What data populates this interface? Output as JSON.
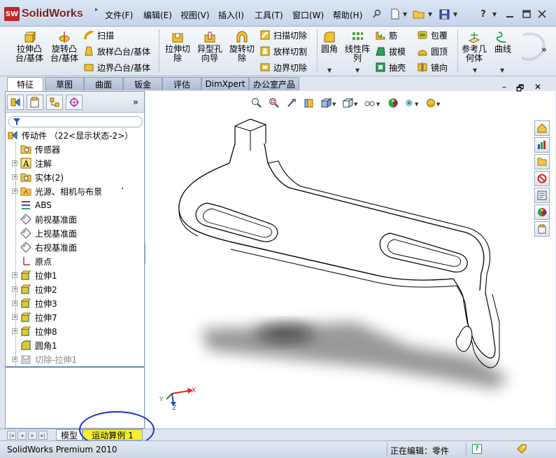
{
  "app": {
    "logo_text": "SolidWorks",
    "logo_badge": "SW"
  },
  "menu": [
    "文件(F)",
    "编辑(E)",
    "视图(V)",
    "插入(I)",
    "工具(T)",
    "窗口(W)",
    "帮助(H)"
  ],
  "toolbar_icons": [
    "pin-icon",
    "new-doc-icon",
    "open-folder-icon",
    "save-icon",
    "help-icon",
    "minimize-icon",
    "restore-icon",
    "close-icon"
  ],
  "commands": {
    "extrude_boss": "拉伸凸台/基体",
    "revolve_boss": "旋转凸台/基体",
    "sweep": "扫描",
    "loft_boss": "放样凸台/基体",
    "boundary_boss": "边界凸台/基体",
    "extrude_cut": "拉伸切除",
    "hole_wizard": "异型孔向导",
    "revolve_cut": "旋转切除",
    "swept_cut": "扫描切除",
    "lofted_cut": "放样切割",
    "boundary_cut": "边界切除",
    "fillet": "圆角",
    "linear_pattern": "线性阵列",
    "rib": "筋",
    "draft": "拔模",
    "shell": "抽壳",
    "wrap": "包覆",
    "dome": "圆顶",
    "mirror": "镜向",
    "ref_geometry": "参考几何体",
    "curves": "曲线"
  },
  "tabs": [
    "特征",
    "草图",
    "曲面",
    "钣金",
    "评估",
    "DimXpert",
    "办公室产品"
  ],
  "tree": {
    "root": "传动件 （22<显示状态-2>）",
    "items": [
      "传感器",
      "注解",
      "实体(2)",
      "光源、相机与布景",
      "ABS",
      "前视基准面",
      "上视基准面",
      "右视基准面",
      "原点",
      "拉伸1",
      "拉伸2",
      "拉伸3",
      "拉伸7",
      "拉伸8",
      "圆角1",
      "切除-拉伸1"
    ]
  },
  "triad": {
    "x": "X",
    "y": "Y",
    "z": "Z"
  },
  "bottom_tabs": [
    "模型",
    "运动算例 1"
  ],
  "status": {
    "product": "SolidWorks Premium 2010",
    "editing": "正在编辑：零件"
  },
  "colors": {
    "active_motion_tab": "#f6f12c",
    "annotation": "#1b2fd2",
    "extrude_icon": "#f2c12e"
  }
}
